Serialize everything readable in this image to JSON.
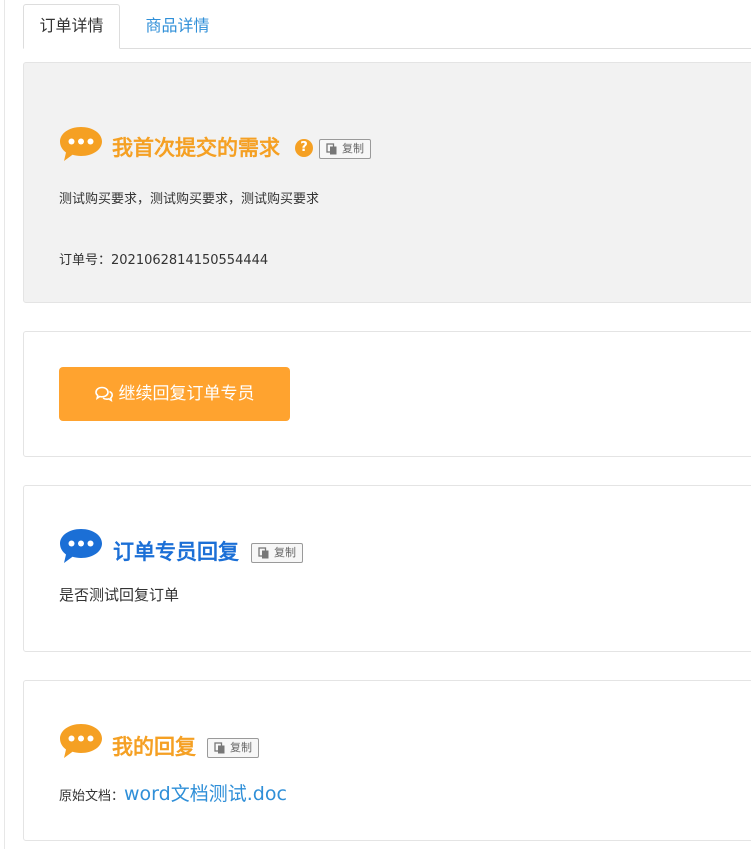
{
  "tabs": [
    {
      "label": "订单详情",
      "active": true
    },
    {
      "label": "商品详情",
      "active": false
    }
  ],
  "requirement": {
    "title": "我首次提交的需求",
    "help_icon": "question-circle-icon",
    "copy_label": "复制",
    "body": "测试购买要求，测试购买要求，测试购买要求",
    "order_no_label": "订单号：",
    "order_no": "2021062814150554444"
  },
  "reply_action": {
    "label": "继续回复订单专员",
    "icon": "comments-icon"
  },
  "agent_reply": {
    "title": "订单专员回复",
    "copy_label": "复制",
    "body": "是否测试回复订单"
  },
  "my_reply": {
    "title": "我的回复",
    "copy_label": "复制",
    "attachment_label": "原始文档：",
    "attachment_name": "word文档测试.doc"
  },
  "colors": {
    "accent_orange": "#f5a023",
    "button_orange": "#ffa32f",
    "agent_blue": "#1b6fd6",
    "link_blue": "#2f8fd8"
  }
}
